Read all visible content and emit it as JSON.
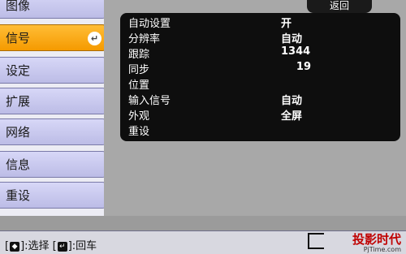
{
  "sidebar": {
    "items": [
      {
        "label": "图像",
        "active": false
      },
      {
        "label": "信号",
        "active": true
      },
      {
        "label": "设定",
        "active": false
      },
      {
        "label": "扩展",
        "active": false
      },
      {
        "label": "网络",
        "active": false
      },
      {
        "label": "信息",
        "active": false
      },
      {
        "label": "重设",
        "active": false
      }
    ],
    "enter_glyph": "↵"
  },
  "header": {
    "back_label": "返回"
  },
  "settings": {
    "rows": [
      {
        "label": "自动设置",
        "value": "开"
      },
      {
        "label": "分辨率",
        "value": "自动"
      },
      {
        "label": "跟踪",
        "value": "1344"
      },
      {
        "label": "同步",
        "value": "19"
      },
      {
        "label": "位置",
        "value": ""
      },
      {
        "label": "输入信号",
        "value": "自动"
      },
      {
        "label": "外观",
        "value": "全屏"
      },
      {
        "label": "重设",
        "value": ""
      }
    ]
  },
  "footer": {
    "hint_open": "[",
    "select_glyph": "◆",
    "select_label": "]:选择 [",
    "enter_glyph": "↵",
    "enter_label": "]:回车"
  },
  "watermark": {
    "text_cn": "投影时代",
    "text_en": "PjTime.com"
  },
  "colors": {
    "active": "#f59a00",
    "panel": "#0e0e0e",
    "sidebar": "#c8c8f0"
  }
}
